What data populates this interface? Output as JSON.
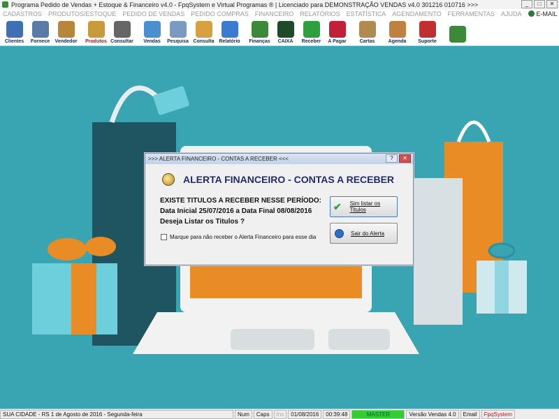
{
  "window": {
    "title": "Programa Pedido de Vendas + Estoque & Financeiro v4.0 - FpqSystem e Virtual Programas ® | Licenciado para  DEMONSTRAÇÃO VENDAS v4.0 301216 010716 >>>",
    "buttons": [
      "_",
      "□",
      "✕"
    ]
  },
  "menu": {
    "items": [
      "CADASTROS",
      "PRODUTOS/ESTOQUE",
      "PEDIDO DE VENDAS",
      "PEDIDO COMPRAS",
      "FINANCEIRO",
      "RELATÓRIOS",
      "ESTATÍSTICA",
      "AGENDAMENTO",
      "FERRAMENTAS",
      "AJUDA"
    ],
    "email": "E-MAIL"
  },
  "toolbar": {
    "buttons": [
      {
        "label": "Clientes",
        "color": "#3f6fb5"
      },
      {
        "label": "Fornece",
        "color": "#5a7aa8"
      },
      {
        "label": "Vendedor",
        "color": "#b8863a"
      },
      {
        "label": "Produtos",
        "color": "#c89a3a"
      },
      {
        "label": "Consultar",
        "color": "#666666"
      },
      {
        "label": "Vendas",
        "color": "#4a8fd0"
      },
      {
        "label": "Pesquisa",
        "color": "#7a9ac0"
      },
      {
        "label": "Consulta",
        "color": "#d8a040"
      },
      {
        "label": "Relatório",
        "color": "#3a7ad0"
      },
      {
        "label": "Finanças",
        "color": "#3a8a3a"
      },
      {
        "label": "CAIXA",
        "color": "#1f4a2a"
      },
      {
        "label": "Receber",
        "color": "#2ea040"
      },
      {
        "label": "A Pagar",
        "color": "#c0203a"
      },
      {
        "label": "Cartas",
        "color": "#b08a50"
      },
      {
        "label": "Agenda",
        "color": "#c08040"
      },
      {
        "label": "Suporte",
        "color": "#c03030"
      },
      {
        "label": "",
        "color": "#3a8a3a"
      }
    ]
  },
  "dialog": {
    "title": ">>> ALERTA FINANCEIRO - CONTAS A RECEBER <<<",
    "heading": "ALERTA FINANCEIRO - CONTAS A RECEBER",
    "line1": "EXISTE TITULOS A RECEBER NESSE PERÍODO:",
    "line2": "Data Inicial 25/07/2016 a Data Final 08/08/2016",
    "line3": "Deseja Listar os Titulos ?",
    "checkbox_label": "Marque para não receber o Alerta Financeiro para esse dia",
    "btn_list": "Sim listar os Titulos",
    "btn_exit": "Sair do Alerta",
    "help_btn": "?",
    "close_btn": "✕"
  },
  "status": {
    "city": "SUA CIDADE - RS   1 de Agosto de 2016 - Segunda-feira",
    "num": "Num",
    "caps": "Caps",
    "ins": "Ins",
    "date": "01/08/2016",
    "time": "00:39:48",
    "user": "MASTER",
    "version": "Versão Vendas 4.0",
    "email": "Email",
    "brand": "FpqSystem"
  }
}
